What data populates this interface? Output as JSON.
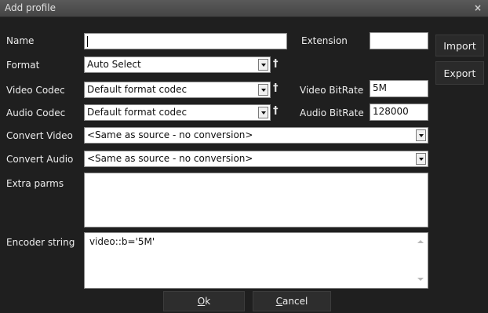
{
  "window": {
    "title": "Add profile",
    "close_label": "×"
  },
  "labels": {
    "name": "Name",
    "extension": "Extension",
    "format": "Format",
    "video_codec": "Video Codec",
    "video_bitrate": "Video BitRate",
    "audio_codec": "Audio Codec",
    "audio_bitrate": "Audio BitRate",
    "convert_video": "Convert Video",
    "convert_audio": "Convert Audio",
    "extra_parms": "Extra parms",
    "encoder_string": "Encoder string"
  },
  "fields": {
    "name": "",
    "extension": "",
    "format": "Auto Select",
    "video_codec": "Default format codec",
    "audio_codec": "Default format codec",
    "video_bitrate": "5M",
    "audio_bitrate": "128000",
    "convert_video": "<Same as source - no conversion>",
    "convert_audio": "<Same as source - no conversion>",
    "extra_parms": "",
    "encoder_string": "video::b='5M'"
  },
  "buttons": {
    "import": "Import",
    "export": "Export",
    "ok_key": "O",
    "ok_rest": "k",
    "cancel_key": "C",
    "cancel_rest": "ancel"
  },
  "icons": {
    "pin": "pin-icon",
    "dropdown": "chevron-down-icon",
    "close": "close-icon"
  }
}
